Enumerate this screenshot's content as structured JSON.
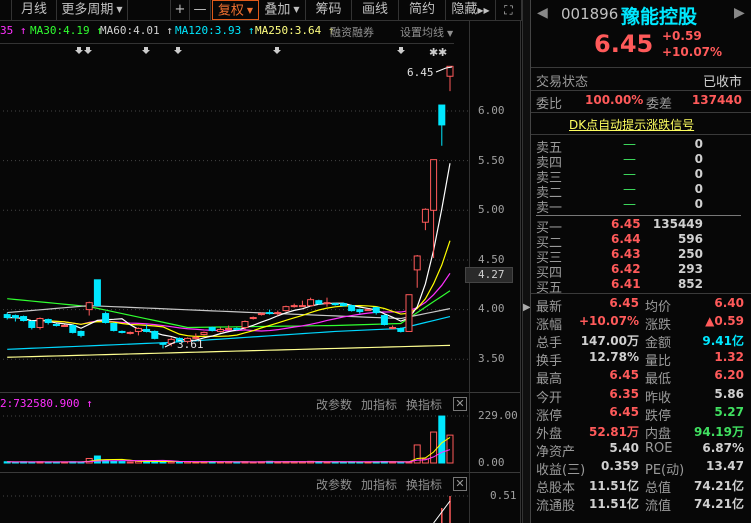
{
  "toolbar": {
    "items": [
      "月线",
      "更多周期",
      "+",
      "—",
      "复权",
      "叠加",
      "筹码",
      "画线",
      "简约",
      "隐藏"
    ],
    "active": "复权"
  },
  "ma_legend": [
    {
      "text": "35 ↑",
      "color": "#ff30ff"
    },
    {
      "text": "MA30:4.19 ↑",
      "color": "#30ff30"
    },
    {
      "text": "MA60:4.01 ↑",
      "color": "#d0d0d0"
    },
    {
      "text": "MA120:3.93 ↑",
      "color": "#00e8ff"
    },
    {
      "text": "MA250:3.64 ↑",
      "color": "#ffff80"
    }
  ],
  "margin_label": "融资融券",
  "set_ma_label": "设置均线",
  "price_axis": {
    "ticks": [
      "6.00",
      "5.50",
      "5.00",
      "4.50",
      "4.00",
      "3.50"
    ],
    "current": "4.27"
  },
  "annotations": {
    "high": "6.45",
    "low": "3.61"
  },
  "candles": [
    [
      3.95,
      3.97,
      3.9,
      3.92
    ],
    [
      3.94,
      3.95,
      3.88,
      3.92
    ],
    [
      3.93,
      3.94,
      3.88,
      3.89
    ],
    [
      3.88,
      3.89,
      3.8,
      3.82
    ],
    [
      3.82,
      3.92,
      3.8,
      3.91
    ],
    [
      3.9,
      3.91,
      3.85,
      3.87
    ],
    [
      3.85,
      3.86,
      3.83,
      3.84
    ],
    [
      3.84,
      3.85,
      3.83,
      3.84
    ],
    [
      3.84,
      3.85,
      3.76,
      3.77
    ],
    [
      3.78,
      3.79,
      3.72,
      3.74
    ],
    [
      4.0,
      4.08,
      3.94,
      4.07
    ],
    [
      4.3,
      4.3,
      4.03,
      4.04
    ],
    [
      3.96,
      3.98,
      3.86,
      3.87
    ],
    [
      3.86,
      3.87,
      3.78,
      3.79
    ],
    [
      3.78,
      3.79,
      3.76,
      3.77
    ],
    [
      3.76,
      3.78,
      3.75,
      3.77
    ],
    [
      3.78,
      3.82,
      3.74,
      3.81
    ],
    [
      3.8,
      3.85,
      3.77,
      3.78
    ],
    [
      3.78,
      3.79,
      3.7,
      3.71
    ],
    [
      3.66,
      3.67,
      3.61,
      3.65
    ],
    [
      3.66,
      3.72,
      3.63,
      3.7
    ],
    [
      3.71,
      3.72,
      3.67,
      3.68
    ],
    [
      3.68,
      3.72,
      3.66,
      3.71
    ],
    [
      3.72,
      3.76,
      3.7,
      3.72
    ],
    [
      3.75,
      3.78,
      3.74,
      3.77
    ],
    [
      3.82,
      3.83,
      3.78,
      3.79
    ],
    [
      3.78,
      3.82,
      3.77,
      3.8
    ],
    [
      3.8,
      3.84,
      3.79,
      3.81
    ],
    [
      3.81,
      3.82,
      3.79,
      3.8
    ],
    [
      3.82,
      3.89,
      3.8,
      3.88
    ],
    [
      3.91,
      3.93,
      3.9,
      3.92
    ],
    [
      3.95,
      3.97,
      3.94,
      3.96
    ],
    [
      3.97,
      4.0,
      3.95,
      3.96
    ],
    [
      3.96,
      3.99,
      3.94,
      3.97
    ],
    [
      3.99,
      4.04,
      3.98,
      4.03
    ],
    [
      4.03,
      4.06,
      4.02,
      4.04
    ],
    [
      4.04,
      4.09,
      4.03,
      4.04
    ],
    [
      4.04,
      4.12,
      4.03,
      4.1
    ],
    [
      4.09,
      4.1,
      4.05,
      4.06
    ],
    [
      4.06,
      4.12,
      4.03,
      4.07
    ],
    [
      4.06,
      4.07,
      4.04,
      4.05
    ],
    [
      4.06,
      4.07,
      4.03,
      4.04
    ],
    [
      4.04,
      4.05,
      3.98,
      3.99
    ],
    [
      4.0,
      4.01,
      3.96,
      3.98
    ],
    [
      4.0,
      4.01,
      3.99,
      4.0
    ],
    [
      4.02,
      4.03,
      3.95,
      3.97
    ],
    [
      3.94,
      3.95,
      3.84,
      3.85
    ],
    [
      3.81,
      3.84,
      3.8,
      3.82
    ],
    [
      3.81,
      3.82,
      3.77,
      3.78
    ],
    [
      3.78,
      4.15,
      3.78,
      4.15
    ],
    [
      4.4,
      4.55,
      4.22,
      4.54
    ],
    [
      4.88,
      5.02,
      4.8,
      5.01
    ],
    [
      5.0,
      5.51,
      4.52,
      5.51
    ],
    [
      6.06,
      6.06,
      5.65,
      5.86
    ],
    [
      6.35,
      6.45,
      6.2,
      6.45
    ]
  ],
  "volumes": [
    6,
    5,
    6,
    5,
    6,
    5,
    5,
    5,
    6,
    5,
    22,
    34,
    14,
    10,
    7,
    5,
    8,
    9,
    10,
    6,
    6,
    5,
    6,
    5,
    6,
    7,
    5,
    6,
    5,
    6,
    5,
    6,
    8,
    5,
    6,
    6,
    6,
    8,
    7,
    5,
    5,
    5,
    6,
    5,
    5,
    6,
    7,
    6,
    5,
    5,
    88,
    20,
    151,
    229,
    136
  ],
  "ma_anchors": {
    "ma30": {
      "color": "#30ff30",
      "pts": [
        [
          0,
          4.11
        ],
        [
          10,
          4.03
        ],
        [
          22,
          3.82
        ],
        [
          40,
          3.84
        ],
        [
          48,
          3.86
        ],
        [
          54,
          4.19
        ]
      ]
    },
    "ma60": {
      "color": "#c8c8c8",
      "pts": [
        [
          0,
          3.97
        ],
        [
          10,
          4.04
        ],
        [
          30,
          3.97
        ],
        [
          48,
          3.91
        ],
        [
          54,
          4.01
        ]
      ]
    },
    "ma120": {
      "color": "#00d8ff",
      "pts": [
        [
          0,
          3.6
        ],
        [
          20,
          3.67
        ],
        [
          40,
          3.78
        ],
        [
          48,
          3.81
        ],
        [
          54,
          3.93
        ]
      ]
    },
    "ma250": {
      "color": "#ffff90",
      "pts": [
        [
          0,
          3.52
        ],
        [
          54,
          3.64
        ]
      ]
    }
  },
  "volume_panel": {
    "label": "2:732580.900 ↑",
    "ticks": [
      "229.00",
      "0.00"
    ],
    "buttons": [
      "改参数",
      "加指标",
      "换指标"
    ]
  },
  "third_panel": {
    "tick": "0.51",
    "buttons": [
      "改参数",
      "加指标",
      "换指标"
    ]
  },
  "quote": {
    "code": "001896",
    "name": "豫能控股",
    "price": "6.45",
    "change": "+0.59",
    "pct": "+10.07%"
  },
  "status": {
    "label": "交易状态",
    "value": "已收市"
  },
  "ratio": {
    "label1": "委比",
    "value1": "100.00%",
    "label2": "委差",
    "value2": "137440"
  },
  "dk_link": "DK点自动提示涨跌信号",
  "asks": [
    {
      "label": "卖五",
      "price": "—",
      "vol": "0"
    },
    {
      "label": "卖四",
      "price": "—",
      "vol": "0"
    },
    {
      "label": "卖三",
      "price": "—",
      "vol": "0"
    },
    {
      "label": "卖二",
      "price": "—",
      "vol": "0"
    },
    {
      "label": "卖一",
      "price": "—",
      "vol": "0"
    }
  ],
  "bids": [
    {
      "label": "买一",
      "price": "6.45",
      "vol": "135449"
    },
    {
      "label": "买二",
      "price": "6.44",
      "vol": "596"
    },
    {
      "label": "买三",
      "price": "6.43",
      "vol": "250"
    },
    {
      "label": "买四",
      "price": "6.42",
      "vol": "293"
    },
    {
      "label": "买五",
      "price": "6.41",
      "vol": "852"
    }
  ],
  "stats": [
    {
      "l1": "最新",
      "v1": "6.45",
      "c1": "red",
      "l2": "均价",
      "v2": "6.40",
      "c2": "red"
    },
    {
      "l1": "涨幅",
      "v1": "+10.07%",
      "c1": "red",
      "l2": "涨跌",
      "v2": "▲0.59",
      "c2": "red"
    },
    {
      "l1": "总手",
      "v1": "147.00万",
      "c1": "wh",
      "l2": "金额",
      "v2": "9.41亿",
      "c2": "cy"
    },
    {
      "l1": "换手",
      "v1": "12.78%",
      "c1": "wh",
      "l2": "量比",
      "v2": "1.32",
      "c2": "red"
    },
    {
      "l1": "最高",
      "v1": "6.45",
      "c1": "red",
      "l2": "最低",
      "v2": "6.20",
      "c2": "red"
    },
    {
      "l1": "今开",
      "v1": "6.35",
      "c1": "red",
      "l2": "昨收",
      "v2": "5.86",
      "c2": "wh"
    },
    {
      "l1": "涨停",
      "v1": "6.45",
      "c1": "red",
      "l2": "跌停",
      "v2": "5.27",
      "c2": "gr"
    },
    {
      "l1": "外盘",
      "v1": "52.81万",
      "c1": "red",
      "l2": "内盘",
      "v2": "94.19万",
      "c2": "gr"
    },
    {
      "l1": "净资产",
      "v1": "5.40",
      "c1": "wh",
      "l2": "ROE",
      "v2": "6.87%",
      "c2": "wh"
    },
    {
      "l1": "收益(三)",
      "v1": "0.359",
      "c1": "wh",
      "l2": "PE(动)",
      "v2": "13.47",
      "c2": "wh"
    },
    {
      "l1": "总股本",
      "v1": "11.51亿",
      "c1": "wh",
      "l2": "总值",
      "v2": "74.21亿",
      "c2": "wh"
    },
    {
      "l1": "流通股",
      "v1": "11.51亿",
      "c1": "wh",
      "l2": "流值",
      "v2": "74.21亿",
      "c2": "wh"
    }
  ],
  "colors": {
    "up": "#ff5a5a",
    "down": "#00e8ff",
    "ma5": "#ffffff",
    "ma10": "#ffff00",
    "ma20": "#ff30ff"
  }
}
